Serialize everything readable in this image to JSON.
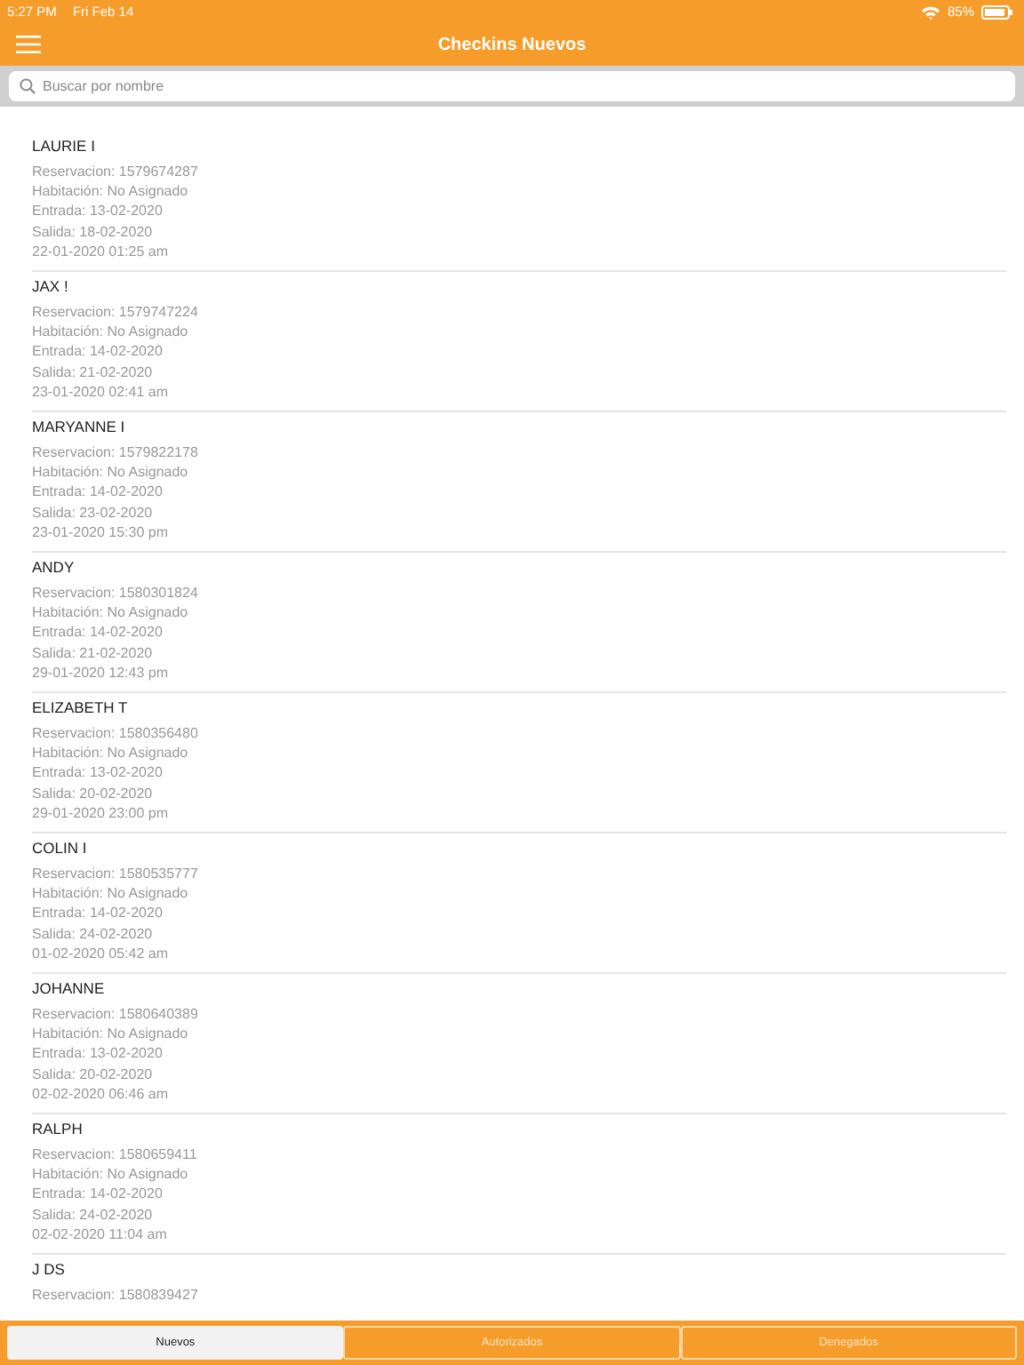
{
  "status_bar": {
    "time": "5:27 PM",
    "date": "Fri Feb 14",
    "battery": "85%"
  },
  "nav": {
    "title": "Checkins Nuevos"
  },
  "search": {
    "placeholder": "Buscar por nombre"
  },
  "checkins": [
    {
      "name": "LAURIE I",
      "lines": [
        "Reservacion: 1579674287",
        "Habitación: No Asignado",
        "Entrada: 13-02-2020",
        "Salida: 18-02-2020",
        "22-01-2020 01:25 am"
      ]
    },
    {
      "name": "JAX !",
      "lines": [
        "Reservacion: 1579747224",
        "Habitación: No Asignado",
        "Entrada: 14-02-2020",
        "Salida: 21-02-2020",
        "23-01-2020 02:41 am"
      ]
    },
    {
      "name": "MARYANNE I",
      "lines": [
        "Reservacion: 1579822178",
        "Habitación: No Asignado",
        "Entrada: 14-02-2020",
        "Salida: 23-02-2020",
        "23-01-2020 15:30 pm"
      ]
    },
    {
      "name": "ANDY",
      "lines": [
        "Reservacion: 1580301824",
        "Habitación: No Asignado",
        "Entrada: 14-02-2020",
        "Salida: 21-02-2020",
        "29-01-2020 12:43 pm"
      ]
    },
    {
      "name": "ELIZABETH T",
      "lines": [
        "Reservacion: 1580356480",
        "Habitación: No Asignado",
        "Entrada: 13-02-2020",
        "Salida: 20-02-2020",
        "29-01-2020 23:00 pm"
      ]
    },
    {
      "name": "COLIN I",
      "lines": [
        "Reservacion: 1580535777",
        "Habitación: No Asignado",
        "Entrada: 14-02-2020",
        "Salida: 24-02-2020",
        "01-02-2020 05:42 am"
      ]
    },
    {
      "name": "JOHANNE",
      "lines": [
        "Reservacion: 1580640389",
        "Habitación: No Asignado",
        "Entrada: 13-02-2020",
        "Salida: 20-02-2020",
        "02-02-2020 06:46 am"
      ]
    },
    {
      "name": "RALPH",
      "lines": [
        "Reservacion: 1580659411",
        "Habitación: No Asignado",
        "Entrada: 14-02-2020",
        "Salida: 24-02-2020",
        "02-02-2020 11:04 am"
      ]
    },
    {
      "name": "J DS",
      "lines": [
        "Reservacion: 1580839427"
      ]
    }
  ],
  "tabs": [
    {
      "label": "Nuevos",
      "selected": true
    },
    {
      "label": "Autorizados",
      "selected": false
    },
    {
      "label": "Denegados",
      "selected": false
    }
  ]
}
